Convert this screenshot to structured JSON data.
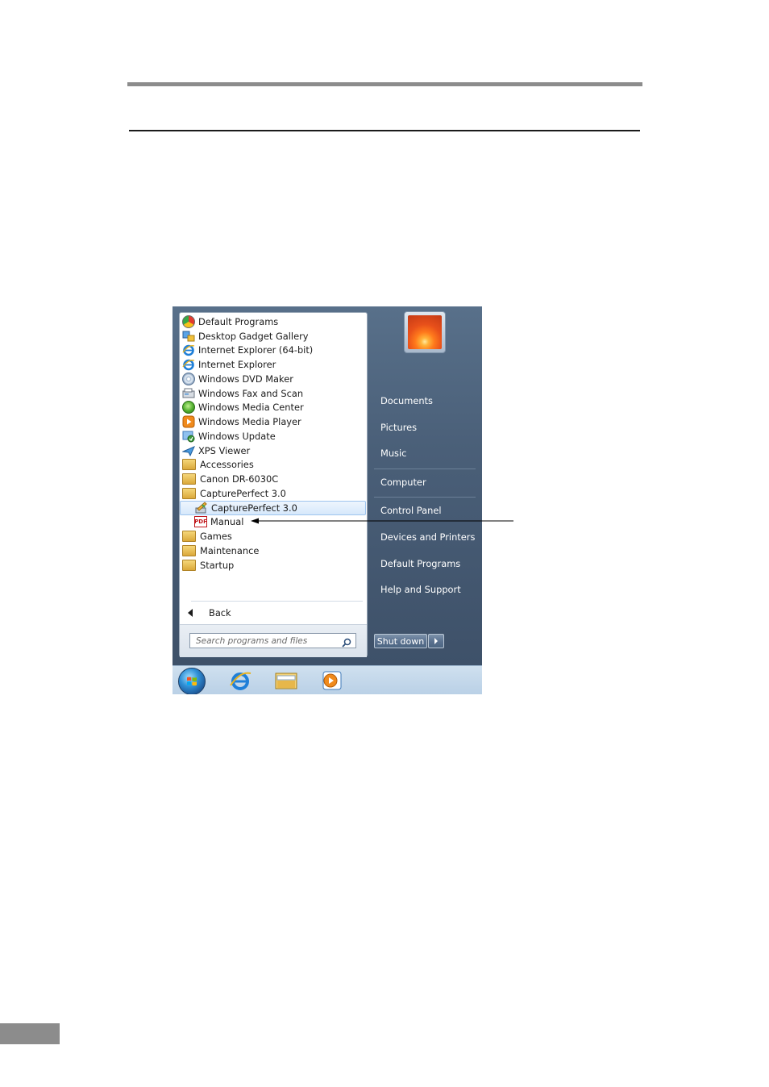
{
  "start_menu": {
    "programs": [
      {
        "label": "Default Programs",
        "icon": "default-programs-icon",
        "level": 0
      },
      {
        "label": "Desktop Gadget Gallery",
        "icon": "gadget-gallery-icon",
        "level": 0
      },
      {
        "label": "Internet Explorer (64-bit)",
        "icon": "internet-explorer-icon",
        "level": 0
      },
      {
        "label": "Internet Explorer",
        "icon": "internet-explorer-icon",
        "level": 0
      },
      {
        "label": "Windows DVD Maker",
        "icon": "dvd-maker-icon",
        "level": 0
      },
      {
        "label": "Windows Fax and Scan",
        "icon": "fax-scan-icon",
        "level": 0
      },
      {
        "label": "Windows Media Center",
        "icon": "media-center-icon",
        "level": 0
      },
      {
        "label": "Windows Media Player",
        "icon": "media-player-icon",
        "level": 0
      },
      {
        "label": "Windows Update",
        "icon": "windows-update-icon",
        "level": 0
      },
      {
        "label": "XPS Viewer",
        "icon": "xps-viewer-icon",
        "level": 0
      },
      {
        "label": "Accessories",
        "icon": "folder-icon",
        "level": 0
      },
      {
        "label": "Canon DR-6030C",
        "icon": "folder-icon",
        "level": 0
      },
      {
        "label": "CapturePerfect 3.0",
        "icon": "folder-icon",
        "level": 0
      },
      {
        "label": "CapturePerfect 3.0",
        "icon": "captureperfect-icon",
        "level": 1,
        "highlighted": true
      },
      {
        "label": "Manual",
        "icon": "pdf-icon",
        "level": 1
      },
      {
        "label": "Games",
        "icon": "folder-icon",
        "level": 0
      },
      {
        "label": "Maintenance",
        "icon": "folder-icon",
        "level": 0
      },
      {
        "label": "Startup",
        "icon": "folder-icon",
        "level": 0
      }
    ],
    "back_label": "Back",
    "search_placeholder": "Search programs and files",
    "right_items": [
      "Documents",
      "Pictures",
      "Music",
      "Computer",
      "Control Panel",
      "Devices and Printers",
      "Default Programs",
      "Help and Support"
    ],
    "shutdown_label": "Shut down"
  },
  "taskbar": {
    "icons": [
      "start-orb-icon",
      "internet-explorer-icon",
      "windows-explorer-icon",
      "media-player-icon"
    ]
  },
  "colors": {
    "right_pane": "#4a5f78",
    "highlight": "#d6e8fb",
    "taskbar": "#b9d0e6",
    "page_rule": "#8c8c8c"
  }
}
